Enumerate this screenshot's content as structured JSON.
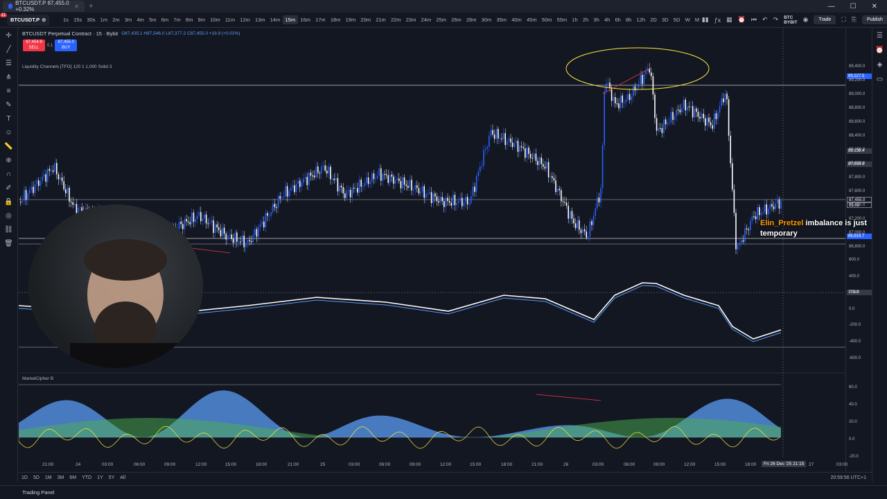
{
  "browser": {
    "tab_title": "BTCUSDT.P 87,455.0 +0.32%",
    "new_tab": "+",
    "controls": [
      "—",
      "☐",
      "✕"
    ]
  },
  "toolbar": {
    "notification_count": "11",
    "symbol": "BTCUSDT.P",
    "timeframes": [
      "1s",
      "15s",
      "30s",
      "1m",
      "2m",
      "3m",
      "4m",
      "5m",
      "6m",
      "7m",
      "8m",
      "9m",
      "10m",
      "11m",
      "12m",
      "13m",
      "14m",
      "15m",
      "16m",
      "17m",
      "18m",
      "19m",
      "20m",
      "21m",
      "22m",
      "23m",
      "24m",
      "25m",
      "26m",
      "28m",
      "30m",
      "35m",
      "40m",
      "45m",
      "50m",
      "55m",
      "1h",
      "2h",
      "3h",
      "4h",
      "6h",
      "8h",
      "12h",
      "2D",
      "3D",
      "5D",
      "W",
      "M"
    ],
    "active_timeframe": "15m",
    "broker": "BTC BYBIT",
    "trade_label": "Trade",
    "publish_label": "Publish"
  },
  "legend": {
    "title": "BTCUSDT Perpetual Contract · 15 · Bybit",
    "ohlc": "O87,435.1 H87,546.0 L87,377.2 C87,455.0 +19.9 (+0.02%)",
    "sell_price": "87,454.9",
    "sell_label": "SELL",
    "spread": "0.1",
    "buy_price": "87,455.0",
    "buy_label": "BUY",
    "indicator": "Liquidity Channels [TFO] 120 1 1,000 Solid 3",
    "market_cipher": "MarketCipher B"
  },
  "price_scale": {
    "labels": [
      "89,400.0",
      "89,200.0",
      "89,000.0",
      "88,800.0",
      "88,600.0",
      "88,400.0",
      "88,200.0",
      "88,000.0",
      "87,800.0",
      "87,600.0",
      "87,400.0",
      "87,200.0",
      "87,000.0",
      "86,800.0",
      "600.0",
      "400.0",
      "200.0",
      "0.0",
      "-200.0",
      "-400.0",
      "-600.0",
      "60.0",
      "40.0",
      "20.0",
      "0.0",
      "-20.0"
    ],
    "tag_high": "89,227.5",
    "tag_mid": "88,138.4",
    "tag_mid2": "87,958.8",
    "tag_current": "87,455.0",
    "tag_timer": "05:03",
    "tag_low": "86,919.7",
    "tag_osc": "173.0"
  },
  "time_axis": {
    "labels": [
      "21:00",
      "24",
      "03:00",
      "06:00",
      "09:00",
      "12:00",
      "15:00",
      "18:00",
      "21:00",
      "25",
      "03:00",
      "06:00",
      "09:00",
      "12:00",
      "15:00",
      "18:00",
      "21:00",
      "26",
      "03:00",
      "06:00",
      "09:00",
      "12:00",
      "15:00",
      "18:00",
      "27",
      "03:00"
    ],
    "crosshair": "Fri 26 Dec '25  21:15"
  },
  "ranges": [
    "1D",
    "5D",
    "1M",
    "3M",
    "6M",
    "YTD",
    "1Y",
    "5Y",
    "All"
  ],
  "clock": "20:59:56 UTC+1",
  "panel_label": "Trading Panel",
  "comment": {
    "user": "Elin_Pretzel",
    "text": "imbalance is just temporary"
  },
  "colors": {
    "background": "#131722",
    "candle_up": "#2962ff",
    "candle_down": "#ffffff",
    "highlight": "#ffeb3b",
    "wave_blue": "#5b9cf6",
    "money_flow_green": "#4caf50"
  }
}
